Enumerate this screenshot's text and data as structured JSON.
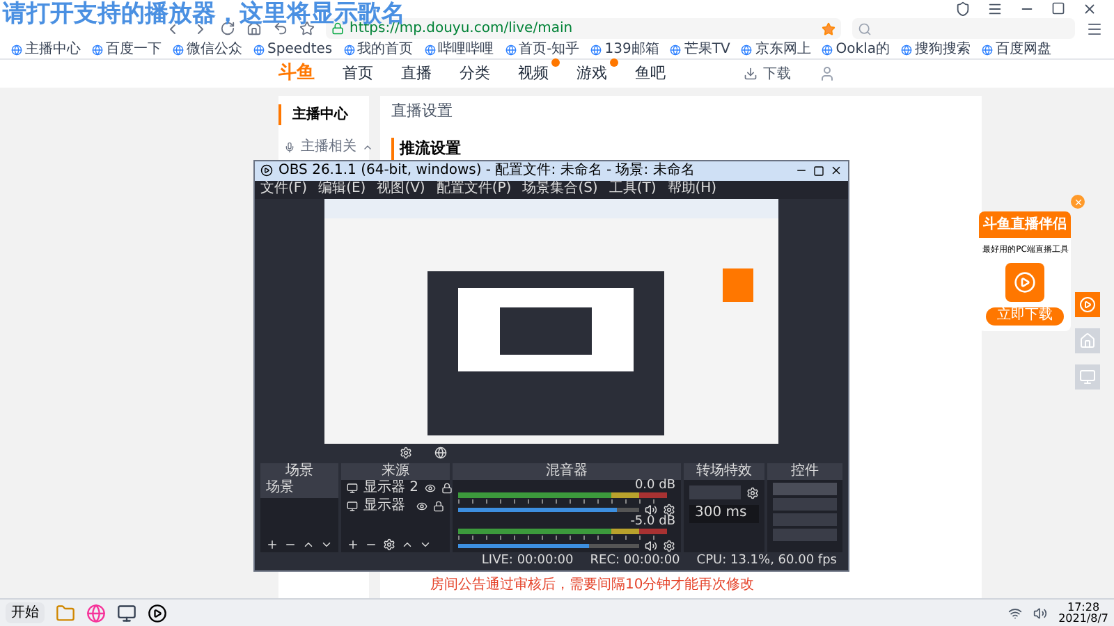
{
  "lyrics": "请打开支持的播放器，这里将显示歌名",
  "browser": {
    "url": "https://mp.douyu.com/live/main"
  },
  "bookmarks": [
    "主播中心",
    "百度一下",
    "微信公众",
    "Speedtes",
    "我的首页",
    "哔哩哔哩",
    "首页-知乎",
    "139邮箱",
    "芒果TV",
    "京东网上",
    "Ookla的",
    "搜狗搜索",
    "百度网盘"
  ],
  "site": {
    "logo": "斗鱼",
    "nav": [
      {
        "label": "首页",
        "badge": false
      },
      {
        "label": "直播",
        "badge": false
      },
      {
        "label": "分类",
        "badge": false
      },
      {
        "label": "视频",
        "badge": true
      },
      {
        "label": "游戏",
        "badge": true
      },
      {
        "label": "鱼吧",
        "badge": false
      }
    ],
    "download": "下载"
  },
  "sidebar": {
    "title": "主播中心",
    "group": {
      "label": "主播相关",
      "expanded": true
    }
  },
  "main": {
    "title": "直播设置",
    "section": "推流设置",
    "notice": "房间公告通过审核后，需要间隔10分钟才能再次修改"
  },
  "promo": {
    "title": "斗鱼直播伴侣",
    "subtitle": "最好用的PC端直播工具",
    "button": "立即下载"
  },
  "obs": {
    "title": "OBS 26.1.1 (64-bit, windows) - 配置文件: 未命名 - 场景: 未命名",
    "menu": [
      "文件(F)",
      "编辑(E)",
      "视图(V)",
      "配置文件(P)",
      "场景集合(S)",
      "工具(T)",
      "帮助(H)"
    ],
    "docks": {
      "scenes": "场景",
      "sources": "来源",
      "mixer": "混音器",
      "transitions": "转场特效",
      "controls": "控件"
    },
    "scenes": [
      {
        "name": "场景",
        "selected": true
      }
    ],
    "sources": [
      {
        "name": "显示器 2"
      },
      {
        "name": "显示器"
      }
    ],
    "mixer": [
      {
        "reading": "0.0 dB",
        "level": 0.88
      },
      {
        "reading": "-5.0 dB",
        "level": 0.72
      }
    ],
    "transition": {
      "duration": "300 ms"
    },
    "status": {
      "live": "LIVE: 00:00:00",
      "rec": "REC: 00:00:00",
      "cpu": "CPU: 13.1%, 60.00 fps"
    }
  },
  "taskbar": {
    "start": "开始",
    "time": "17:28",
    "date": "2021/8/7"
  }
}
